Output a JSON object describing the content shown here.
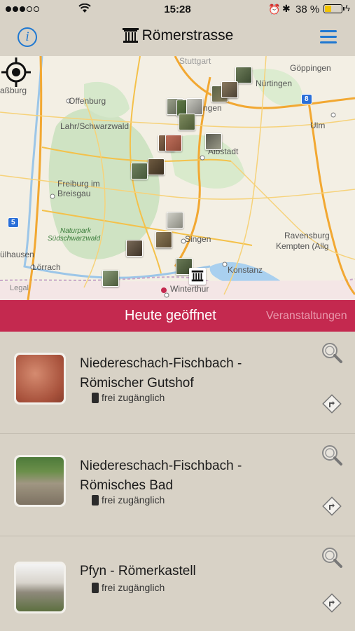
{
  "status_bar": {
    "time": "15:28",
    "battery": "38 %",
    "battery_level": 0.38
  },
  "nav": {
    "title": "Römerstrasse",
    "info_label": "i"
  },
  "map": {
    "places": {
      "strasburg": "aßburg",
      "offenburg": "Offenburg",
      "lahr": "Lahr/Schwarzwald",
      "freiburg_1": "Freiburg im",
      "freiburg_2": "Breisgau",
      "naturpark_1": "Naturpark",
      "naturpark_2": "Südschwarzwald",
      "muelhausen": "ülhausen",
      "loerrach": "Lörrach",
      "stuttgart": "Stuttgart",
      "goeppingen": "Göppingen",
      "nuertingen": "Nürtingen",
      "tuebingen": "ngen",
      "albstadt": "Albstadt",
      "ulm": "Ulm",
      "singen": "Singen",
      "konstanz": "Konstanz",
      "ravensburg": "Ravensburg",
      "kempten": "Kempten (Allg",
      "winterthur": "Winterthur",
      "legal": "Legal"
    },
    "shields": {
      "a5": "5",
      "a8": "8"
    }
  },
  "banner": {
    "active_tab": "Heute geöffnet",
    "next_tab": "Veranstaltungen"
  },
  "list": {
    "items": [
      {
        "name": "Niedereschach-Fischbach - Römischer Gutshof",
        "access": "frei zugänglich"
      },
      {
        "name": "Niedereschach-Fischbach - Römisches Bad",
        "access": "frei zugänglich"
      },
      {
        "name": "Pfyn - Römerkastell",
        "access": "frei zugänglich"
      }
    ]
  }
}
